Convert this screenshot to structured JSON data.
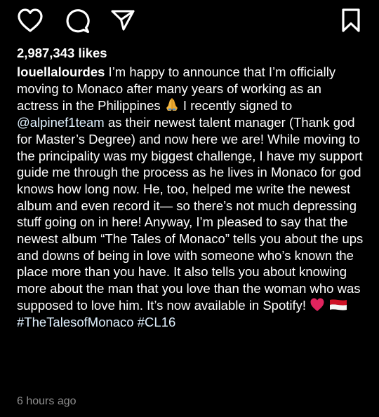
{
  "post": {
    "likes": "2,987,343 likes",
    "username": "louellalourdes",
    "caption": {
      "part1": " I’m happy to announce that I’m officially moving to Monaco after many years of working as an actress in the Philippines ",
      "part2": " I recently signed to ",
      "mention": "@alpinef1team",
      "part3": " as their newest talent manager (Thank god for Master’s Degree) and now here we are! While moving to the principality was my biggest challenge, I have my support guide me through the process as he lives in Monaco for god knows how long now. He, too, helped me write the newest album and even record it— so there’s not much depressing stuff going on in here! Anyway, I’m pleased to say that the newest album “The Tales of Monaco” tells you about the ups and downs of being in love with someone who’s known the place more than you have. It also tells you about knowing more about the man that you love than the woman who was supposed to love him. It’s now available in Spotify! ",
      "hashtag1": "#TheTalesofMonaco",
      "hashtag2": "#CL16"
    },
    "timestamp": "6 hours ago"
  },
  "icons": {
    "like": "heart-outline-icon",
    "comment": "comment-bubble-icon",
    "share": "paper-plane-icon",
    "save": "bookmark-icon",
    "emoji1": "folded-hands-emoji",
    "emoji2": "red-heart-emoji",
    "emoji3": "monaco-flag-emoji"
  },
  "colors": {
    "background": "#000000",
    "text": "#ffffff",
    "link": "#e0f1ff",
    "timestamp": "#8e8e8e",
    "heart_emoji": "#e0245e",
    "flag_red": "#ce1126"
  }
}
